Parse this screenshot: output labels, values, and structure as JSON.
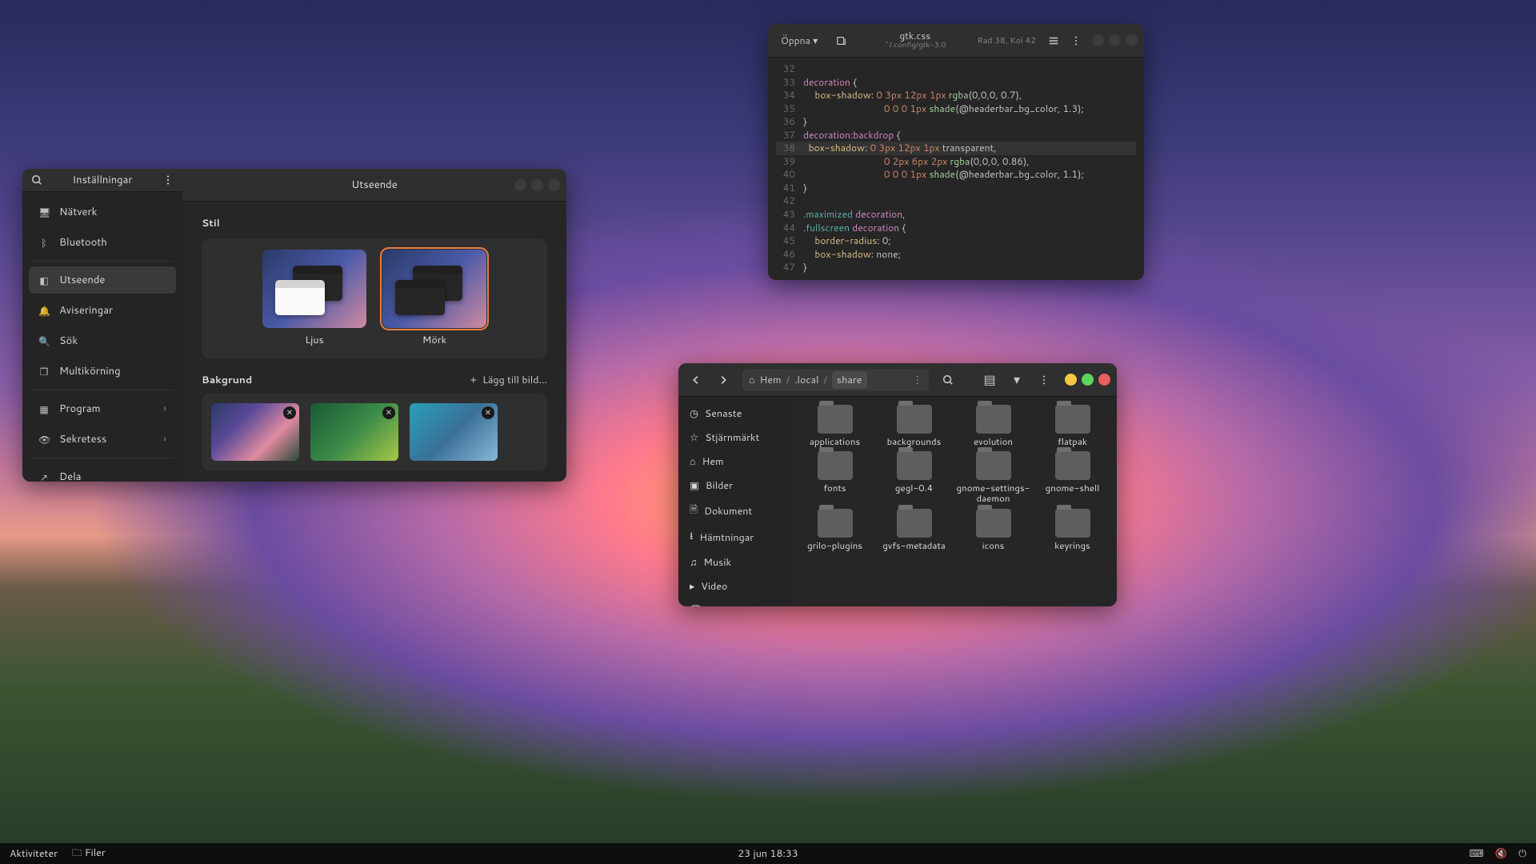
{
  "panel": {
    "activities": "Aktiviteter",
    "files": "Filer",
    "clock": "23 jun  18:33"
  },
  "settings": {
    "sidebar_title": "Inställningar",
    "main_title": "Utseende",
    "nav": {
      "network": "Nätverk",
      "bluetooth": "Bluetooth",
      "appearance": "Utseende",
      "notifications": "Aviseringar",
      "search": "Sök",
      "multitask": "Multikörning",
      "applications": "Program",
      "privacy": "Sekretess",
      "share": "Dela"
    },
    "style": {
      "heading": "Stil",
      "light": "Ljus",
      "dark": "Mörk"
    },
    "background": {
      "heading": "Bakgrund",
      "add": "Lägg till bild…",
      "add_plus": "+"
    }
  },
  "editor": {
    "open": "Öppna",
    "filename": "gtk.css",
    "subtitle": "~/.config/gtk-3.0",
    "status": "Rad 38, Kol 42",
    "lines": {
      "l32": "32",
      "l33a": "decoration",
      "l33b": " {",
      "l34a": "box-shadow",
      "l34b": ": ",
      "l34c": "0",
      "l34d": " ",
      "l34e": "3px",
      "l34f": " ",
      "l34g": "12px",
      "l34h": " ",
      "l34i": "1px",
      "l34j": " ",
      "l34k": "rgba",
      "l34l": "(0,0,0, 0.7),",
      "l35a": "0",
      "l35b": " ",
      "l35c": "0",
      "l35d": " ",
      "l35e": "0",
      "l35f": " ",
      "l35g": "1px",
      "l35h": " ",
      "l35i": "shade",
      "l35j": "(@headerbar_bg_color, 1.3);",
      "l36": "}",
      "l37a": "decoration:backdrop",
      "l37b": " {",
      "l38a": "box-shadow",
      "l38b": ": ",
      "l38c": "0",
      "l38d": " ",
      "l38e": "3px",
      "l38f": " ",
      "l38g": "12px",
      "l38h": " ",
      "l38i": "1px",
      "l38j": " transparent,",
      "l39a": "0",
      "l39b": " ",
      "l39c": "2px",
      "l39d": " ",
      "l39e": "6px",
      "l39f": " ",
      "l39g": "2px",
      "l39h": " ",
      "l39i": "rgba",
      "l39j": "(0,0,0, 0.86),",
      "l40a": "0",
      "l40b": " ",
      "l40c": "0",
      "l40d": " ",
      "l40e": "0",
      "l40f": " ",
      "l40g": "1px",
      "l40h": " ",
      "l40i": "shade",
      "l40j": "(@headerbar_bg_color, 1.1);",
      "l41": "}",
      "l43a": ".maximized",
      "l43b": " ",
      "l43c": "decoration",
      "l43d": ",",
      "l44a": ".fullscreen",
      "l44b": " ",
      "l44c": "decoration",
      "l44d": " {",
      "l45a": "border-radius",
      "l45b": ": 0;",
      "l46a": "box-shadow",
      "l46b": ": none;",
      "l47": "}"
    }
  },
  "files": {
    "path": {
      "home": "Hem",
      "local": ".local",
      "share": "share"
    },
    "places": {
      "recent": "Senaste",
      "starred": "Stjärnmärkt",
      "home": "Hem",
      "pictures": "Bilder",
      "documents": "Dokument",
      "downloads": "Hämtningar",
      "music": "Musik",
      "video": "Video",
      "trash": "Papperskorg"
    },
    "folders": {
      "f0": "applications",
      "f1": "backgrounds",
      "f2": "evolution",
      "f3": "flatpak",
      "f4": "fonts",
      "f5": "gegl-0.4",
      "f6": "gnome-settings-daemon",
      "f7": "gnome-shell",
      "f8": "grilo-plugins",
      "f9": "gvfs-metadata",
      "f10": "icons",
      "f11": "keyrings"
    }
  }
}
